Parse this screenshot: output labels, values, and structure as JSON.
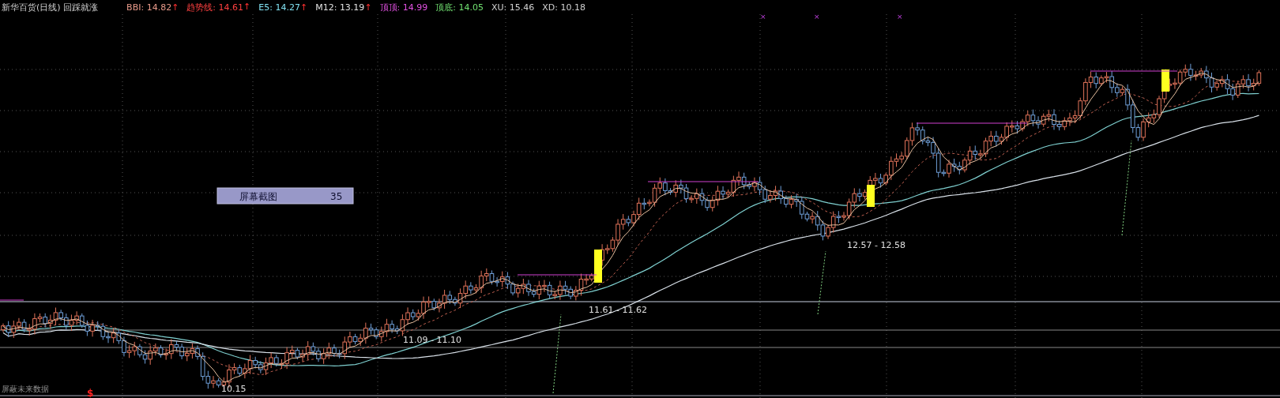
{
  "header": {
    "title": "新华百货(日线) 回踩就涨",
    "indicators": [
      {
        "label": "BBI:",
        "value": "14.82",
        "arrow": "↑",
        "color": "#e89a8a"
      },
      {
        "label": "趋势线:",
        "value": "14.61",
        "arrow": "↑",
        "color": "#ff4040"
      },
      {
        "label": "E5:",
        "value": "14.27",
        "arrow": "↑",
        "color": "#80e0f0"
      },
      {
        "label": "M12:",
        "value": "13.19",
        "arrow": "↑",
        "color": "#e0e0e0"
      },
      {
        "label": "顶顶:",
        "value": "14.99",
        "color": "#e050e0"
      },
      {
        "label": "顶底:",
        "value": "14.05",
        "color": "#70e070"
      },
      {
        "label": "XU:",
        "value": "15.46",
        "color": "#d0d0d0"
      },
      {
        "label": "XD:",
        "value": "10.18",
        "color": "#d0d0d0"
      }
    ]
  },
  "chart": {
    "price_labels": [
      "11.09 - 11.10",
      "11.61 - 11.62",
      "12.57 - 12.58"
    ],
    "low_label": "10.15",
    "overlay": {
      "label": "屏幕截图",
      "value": "35"
    },
    "note": "屏蔽未来数据",
    "signal": "$",
    "top_marks": [
      "×",
      "×",
      "×"
    ]
  }
}
